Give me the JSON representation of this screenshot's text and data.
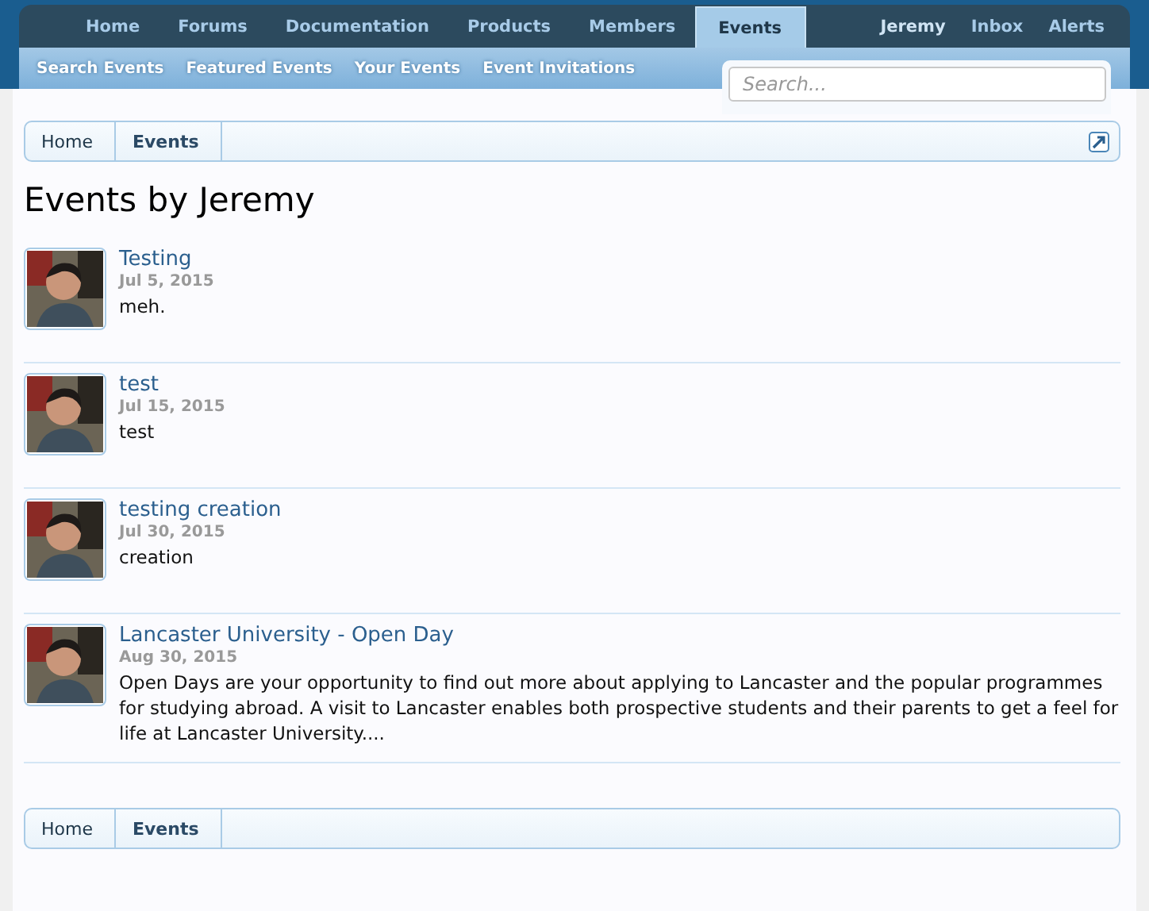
{
  "nav": {
    "tabs": [
      {
        "label": "Home",
        "selected": false
      },
      {
        "label": "Forums",
        "selected": false
      },
      {
        "label": "Documentation",
        "selected": false
      },
      {
        "label": "Products",
        "selected": false
      },
      {
        "label": "Members",
        "selected": false
      },
      {
        "label": "Events",
        "selected": true
      }
    ],
    "user_links": [
      "Jeremy",
      "Inbox",
      "Alerts"
    ]
  },
  "subnav": {
    "links": [
      "Search Events",
      "Featured Events",
      "Your Events",
      "Event Invitations"
    ]
  },
  "search": {
    "placeholder": "Search..."
  },
  "breadcrumb_top": [
    {
      "label": "Home",
      "current": false
    },
    {
      "label": "Events",
      "current": true
    }
  ],
  "page_title": "Events by Jeremy",
  "events": [
    {
      "title": "Testing",
      "date": "Jul 5, 2015",
      "description": "meh."
    },
    {
      "title": "test",
      "date": "Jul 15, 2015",
      "description": "test"
    },
    {
      "title": "testing creation",
      "date": "Jul 30, 2015",
      "description": "creation"
    },
    {
      "title": "Lancaster University - Open Day",
      "date": "Aug 30, 2015",
      "description": "Open Days are your opportunity to find out more about applying to Lancaster and the popular programmes for studying abroad. A visit to Lancaster enables both prospective students and their parents to get a feel for life at Lancaster University...."
    }
  ],
  "breadcrumb_bottom": [
    {
      "label": "Home",
      "current": false
    },
    {
      "label": "Events",
      "current": true
    }
  ]
}
